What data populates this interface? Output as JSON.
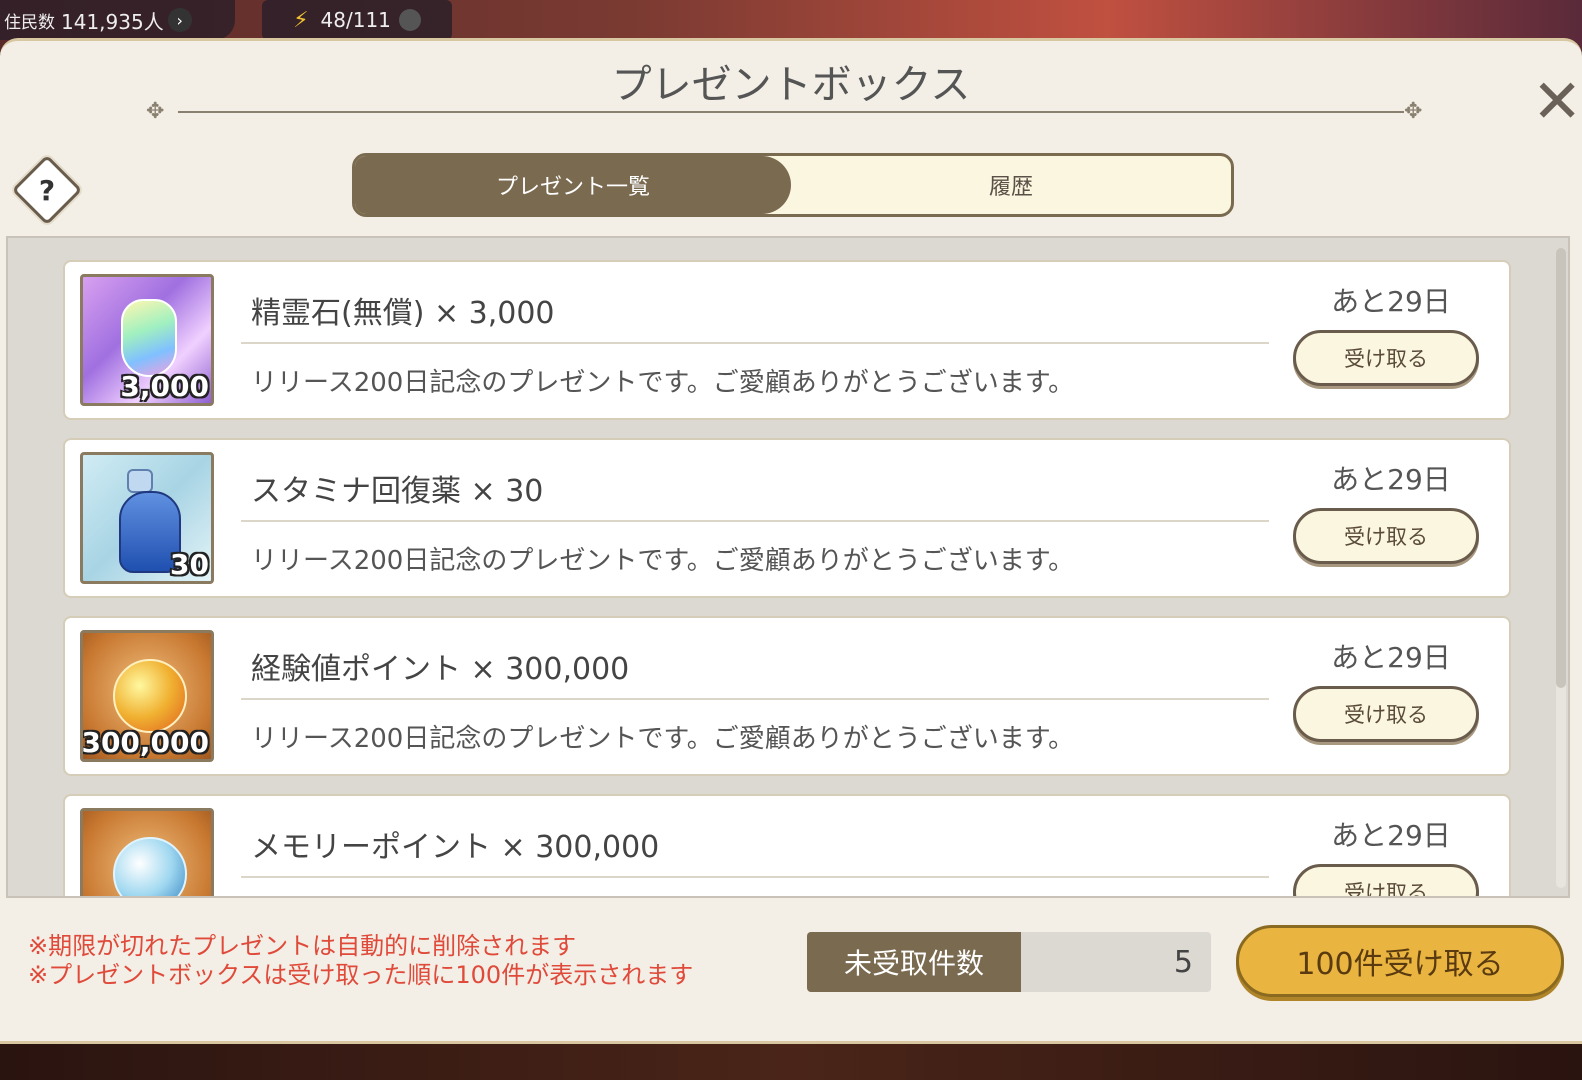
{
  "hud": {
    "residents_label": "住民数",
    "residents_value": "141,935人",
    "stamina_value": "48/111"
  },
  "dialog": {
    "title": "プレゼントボックス",
    "help_symbol": "?",
    "close_symbol": "✕"
  },
  "tabs": [
    {
      "label": "プレゼント一覧",
      "active": true
    },
    {
      "label": "履歴",
      "active": false
    }
  ],
  "presents": [
    {
      "name": "精霊石(無償) × 3,000",
      "quantity_badge": "3,000",
      "description": "リリース200日記念のプレゼントです。ご愛顧ありがとうございます。",
      "remaining": "あと29日",
      "button": "受け取る",
      "icon": "spirit-stone-icon"
    },
    {
      "name": "スタミナ回復薬 × 30",
      "quantity_badge": "30",
      "description": "リリース200日記念のプレゼントです。ご愛顧ありがとうございます。",
      "remaining": "あと29日",
      "button": "受け取る",
      "icon": "stamina-potion-icon"
    },
    {
      "name": "経験値ポイント × 300,000",
      "quantity_badge": "300,000",
      "description": "リリース200日記念のプレゼントです。ご愛顧ありがとうございます。",
      "remaining": "あと29日",
      "button": "受け取る",
      "icon": "exp-orb-icon"
    },
    {
      "name": "メモリーポイント × 300,000",
      "quantity_badge": "",
      "description": "",
      "remaining": "あと29日",
      "button": "受け取る",
      "icon": "memory-orb-icon"
    }
  ],
  "footer": {
    "note1": "※期限が切れたプレゼントは自動的に削除されます",
    "note2": "※プレゼントボックスは受け取った順に100件が表示されます",
    "unclaimed_label": "未受取件数",
    "unclaimed_count": "5",
    "bulk_button": "100件受け取る"
  },
  "colors": {
    "accent": "#7a6a50",
    "bulk_button": "#e9b540",
    "note_text": "#e04a3a"
  }
}
